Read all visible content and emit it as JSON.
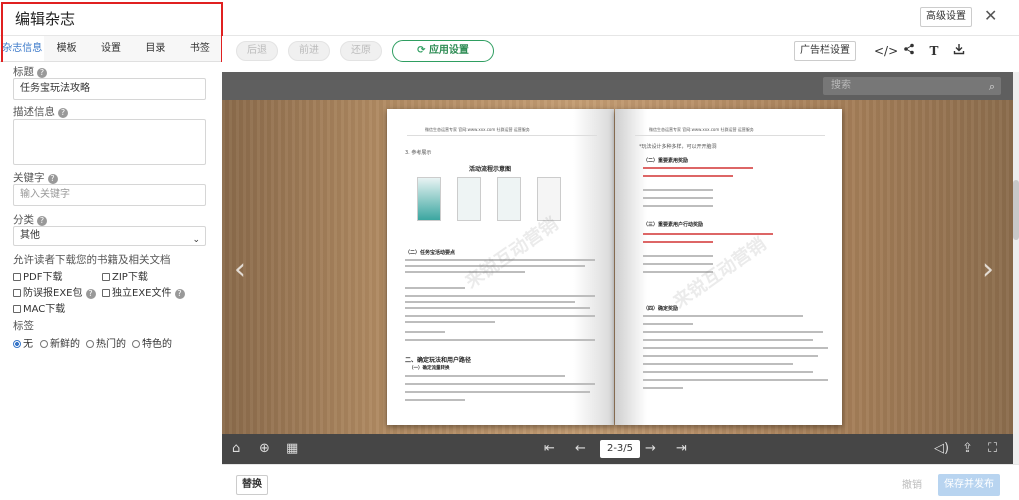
{
  "header": {
    "title": "编辑杂志",
    "advanced_label": "高级设置",
    "close_glyph": "✕"
  },
  "tabs": [
    {
      "label": "杂志信息",
      "active": true
    },
    {
      "label": "模板"
    },
    {
      "label": "设置"
    },
    {
      "label": "目录"
    },
    {
      "label": "书签"
    }
  ],
  "form": {
    "title_label": "标题",
    "title_value": "任务宝玩法攻略",
    "desc_label": "描述信息",
    "keyword_label": "关键字",
    "keyword_placeholder": "输入关键字",
    "category_label": "分类",
    "category_value": "其他",
    "download_label": "允许读者下载您的书籍及相关文档",
    "downloads": {
      "pdf": "PDF下载",
      "zip": "ZIP下载",
      "anti_virus_exe": "防误报EXE包",
      "standalone_exe": "独立EXE文件",
      "mac": "MAC下载"
    },
    "tag_label": "标签",
    "tags": {
      "none": "无",
      "fresh": "新鲜的",
      "hot": "热门的",
      "featured": "特色的"
    },
    "help_glyph": "?"
  },
  "toolbar": {
    "undo": "后退",
    "redo": "前进",
    "reset": "还原",
    "app_settings": "应用设置",
    "ad_settings": "广告栏设置",
    "icons": {
      "embed": "</>",
      "share": "share-icon",
      "text": "T",
      "download": "download-icon"
    }
  },
  "viewer": {
    "search_placeholder": "搜索",
    "page_indicator": "2-3/5",
    "left_page": {
      "header": "微信生态运营专家  官网:www.xxx.com  社群运营  运营服务",
      "section": "3. 参考展示",
      "diagram_title": "活动流程示意图",
      "sub1": "（二）任务宝活动要点",
      "sub2": "二、确定玩法和用户路径",
      "sub3": "（一）确定流量转换",
      "watermark": "来锐互动营销"
    },
    "right_page": {
      "header": "微信生态运营专家  官网:www.xxx.com  社群运营  运营服务",
      "lead": "*玩法设计多种多样，可以开开脑洞",
      "sub1": "（二）重要素用奖励",
      "sub2": "（三）重要素用户行动奖励",
      "sub3": "（四）确定奖励",
      "watermark": "来锐互动营销"
    }
  },
  "bottom": {
    "replace": "替换",
    "discard": "撤销",
    "save": "保存并发布"
  }
}
